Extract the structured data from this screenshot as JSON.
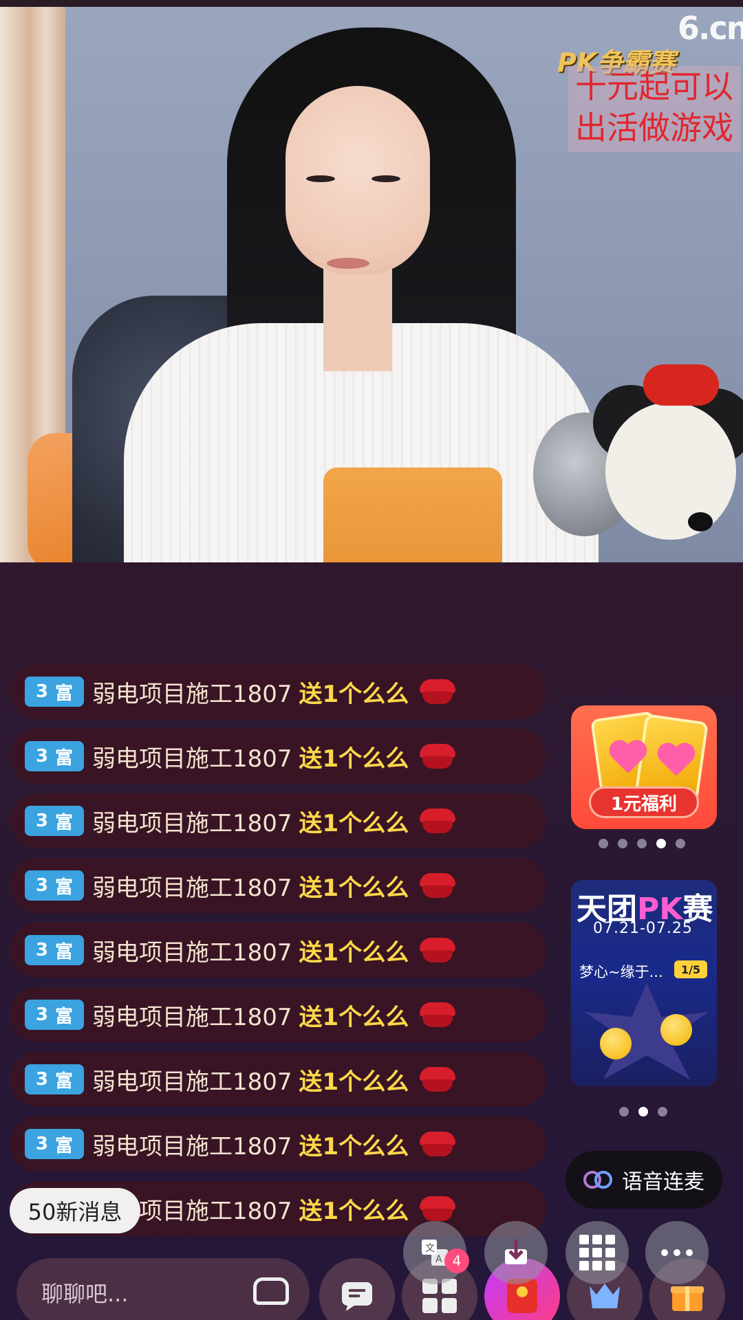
{
  "stream": {
    "logo": "6.cn",
    "pk_overlay_title": "PK争霸赛",
    "promo_text_line1": "十元起可以",
    "promo_text_line2": "出活做游戏"
  },
  "chat": {
    "messages": [
      {
        "level": "3",
        "badge_label": "富",
        "user": "弱电项目施工1807",
        "action": "送1个么么"
      },
      {
        "level": "3",
        "badge_label": "富",
        "user": "弱电项目施工1807",
        "action": "送1个么么"
      },
      {
        "level": "3",
        "badge_label": "富",
        "user": "弱电项目施工1807",
        "action": "送1个么么"
      },
      {
        "level": "3",
        "badge_label": "富",
        "user": "弱电项目施工1807",
        "action": "送1个么么"
      },
      {
        "level": "3",
        "badge_label": "富",
        "user": "弱电项目施工1807",
        "action": "送1个么么"
      },
      {
        "level": "3",
        "badge_label": "富",
        "user": "弱电项目施工1807",
        "action": "送1个么么"
      },
      {
        "level": "3",
        "badge_label": "富",
        "user": "弱电项目施工1807",
        "action": "送1个么么"
      },
      {
        "level": "3",
        "badge_label": "富",
        "user": "弱电项目施工1807",
        "action": "送1个么么"
      },
      {
        "level": "3",
        "badge_label": "富",
        "user": "弱电项目施工1807",
        "action": "送1个么么"
      }
    ],
    "new_messages_label": "50新消息"
  },
  "side": {
    "welfare_label": "1元福利",
    "welfare_dots_count": 5,
    "welfare_active_dot": 4,
    "pk_card": {
      "title_prefix": "天团",
      "title_pk": "PK",
      "title_suffix": "赛",
      "dates": "07.21-07.25",
      "team_name": "梦心~缘于...",
      "page": "1/5"
    },
    "pk_dots_count": 3,
    "pk_active_dot": 2,
    "voice_button_label": "语音连麦"
  },
  "bottom_bar": {
    "input_placeholder": "聊聊吧...",
    "translate_badge": "4",
    "icons": [
      "sofa-icon",
      "chat-icon",
      "grid-icon",
      "red-envelope-icon",
      "crown-icon",
      "gift-icon",
      "translate-icon",
      "download-icon",
      "apps-icon",
      "more-icon"
    ]
  },
  "colors": {
    "badge_blue": "#3aa3e0",
    "gift_yellow": "#ffd84a",
    "welfare_red": "#ff4a3a",
    "pk_blue": "#1e2c7a"
  }
}
